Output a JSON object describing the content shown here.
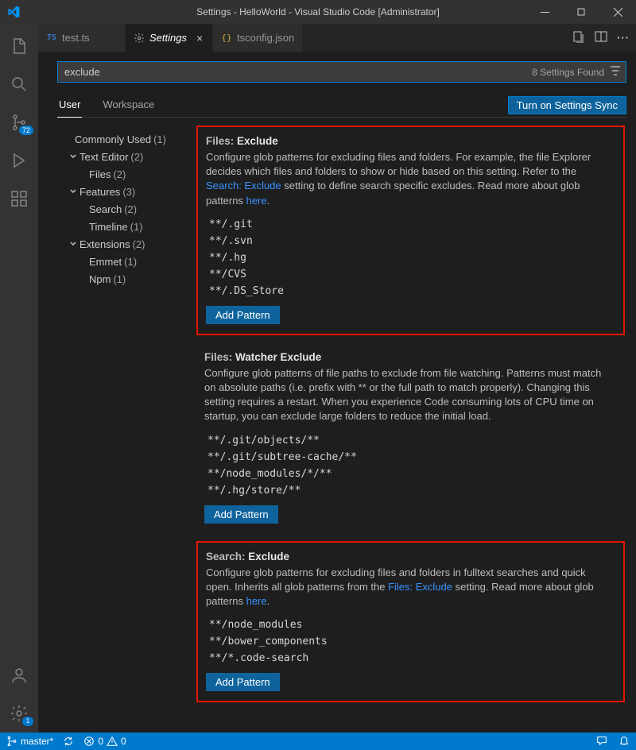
{
  "window": {
    "title": "Settings - HelloWorld - Visual Studio Code [Administrator]"
  },
  "tabs": {
    "items": [
      {
        "label": "test.ts",
        "kind": "ts"
      },
      {
        "label": "Settings",
        "kind": "settings",
        "active": true
      },
      {
        "label": "tsconfig.json",
        "kind": "json"
      }
    ]
  },
  "activity": {
    "scm_badge": "72",
    "manage_badge": "1"
  },
  "search": {
    "value": "exclude",
    "results_label": "8 Settings Found"
  },
  "scope": {
    "user": "User",
    "workspace": "Workspace",
    "sync_button": "Turn on Settings Sync"
  },
  "tree": [
    {
      "label": "Commonly Used",
      "count": "(1)",
      "type": "head"
    },
    {
      "label": "Text Editor",
      "count": "(2)",
      "type": "exp"
    },
    {
      "label": "Files",
      "count": "(2)",
      "type": "sub"
    },
    {
      "label": "Features",
      "count": "(3)",
      "type": "exp"
    },
    {
      "label": "Search",
      "count": "(2)",
      "type": "sub"
    },
    {
      "label": "Timeline",
      "count": "(1)",
      "type": "sub"
    },
    {
      "label": "Extensions",
      "count": "(2)",
      "type": "exp"
    },
    {
      "label": "Emmet",
      "count": "(1)",
      "type": "sub"
    },
    {
      "label": "Npm",
      "count": "(1)",
      "type": "sub"
    }
  ],
  "settings": [
    {
      "cat": "Files:",
      "name": "Exclude",
      "desc_pre": "Configure glob patterns for excluding files and folders. For example, the file Explorer decides which files and folders to show or hide based on this setting. Refer to the ",
      "link1": "Search: Exclude",
      "desc_mid": " setting to define search specific excludes. Read more about glob patterns ",
      "link2": "here",
      "desc_post": ".",
      "patterns": [
        "**/.git",
        "**/.svn",
        "**/.hg",
        "**/CVS",
        "**/.DS_Store"
      ],
      "add": "Add Pattern",
      "highlight": true
    },
    {
      "cat": "Files:",
      "name": "Watcher Exclude",
      "desc_pre": "Configure glob patterns of file paths to exclude from file watching. Patterns must match on absolute paths (i.e. prefix with ** or the full path to match properly). Changing this setting requires a restart. When you experience Code consuming lots of CPU time on startup, you can exclude large folders to reduce the initial load.",
      "link1": "",
      "desc_mid": "",
      "link2": "",
      "desc_post": "",
      "patterns": [
        "**/.git/objects/**",
        "**/.git/subtree-cache/**",
        "**/node_modules/*/**",
        "**/.hg/store/**"
      ],
      "add": "Add Pattern",
      "highlight": false
    },
    {
      "cat": "Search:",
      "name": "Exclude",
      "desc_pre": "Configure glob patterns for excluding files and folders in fulltext searches and quick open. Inherits all glob patterns from the ",
      "link1": "Files: Exclude",
      "desc_mid": " setting. Read more about glob patterns ",
      "link2": "here",
      "desc_post": ".",
      "patterns": [
        "**/node_modules",
        "**/bower_components",
        "**/*.code-search"
      ],
      "add": "Add Pattern",
      "highlight": true
    }
  ],
  "status": {
    "branch": "master*",
    "errors": "0",
    "warnings": "0"
  }
}
